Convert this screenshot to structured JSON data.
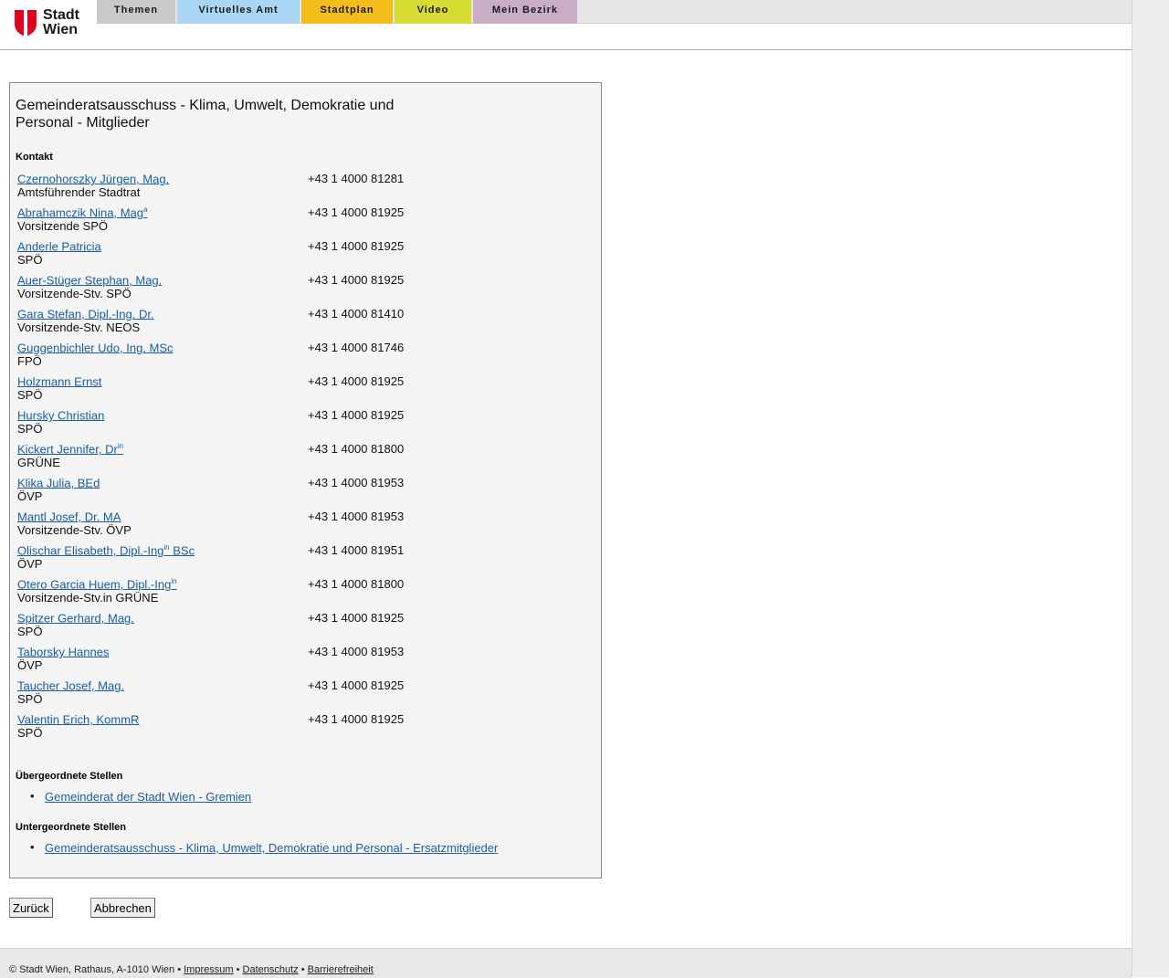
{
  "logo": {
    "line1": "Stadt",
    "line2": "Wien"
  },
  "nav": {
    "tabs": [
      {
        "label": "Themen",
        "color": "#c9c9c9"
      },
      {
        "label": "Virtuelles Amt",
        "color": "#a9d6f2"
      },
      {
        "label": "Stadtplan",
        "color": "#f3be19"
      },
      {
        "label": "Video",
        "color": "#d7dc32"
      },
      {
        "label": "Mein Bezirk",
        "color": "#c9adc6"
      }
    ]
  },
  "panel": {
    "title": "Gemeinderatsausschuss - Klima, Umwelt, Demokratie und Personal - Mitglieder",
    "contact_heading": "Kontakt",
    "members": [
      {
        "name": "Czernohorszky Jürgen, Mag.",
        "sup": "",
        "name_suffix": "",
        "role": "Amtsführender Stadtrat",
        "phone": "+43 1 4000 81281"
      },
      {
        "name": "Abrahamczik Nina, Mag",
        "sup": "a",
        "name_suffix": "",
        "role": "Vorsitzende SPÖ",
        "phone": "+43 1 4000 81925"
      },
      {
        "name": "Anderle Patricia",
        "sup": "",
        "name_suffix": "",
        "role": "SPÖ",
        "phone": "+43 1 4000 81925"
      },
      {
        "name": "Auer-Stüger Stephan, Mag.",
        "sup": "",
        "name_suffix": "",
        "role": "Vorsitzende-Stv. SPÖ",
        "phone": "+43 1 4000 81925"
      },
      {
        "name": "Gara Stefan, Dipl.-Ing. Dr.",
        "sup": "",
        "name_suffix": "",
        "role": "Vorsitzende-Stv. NEOS",
        "phone": "+43 1 4000 81410"
      },
      {
        "name": "Guggenbichler Udo, Ing. MSc",
        "sup": "",
        "name_suffix": "",
        "role": "FPÖ",
        "phone": "+43 1 4000 81746"
      },
      {
        "name": "Holzmann Ernst",
        "sup": "",
        "name_suffix": "",
        "role": "SPÖ",
        "phone": "+43 1 4000 81925"
      },
      {
        "name": "Hursky Christian",
        "sup": "",
        "name_suffix": "",
        "role": "SPÖ",
        "phone": "+43 1 4000 81925"
      },
      {
        "name": "Kickert Jennifer, Dr",
        "sup": "in",
        "name_suffix": "",
        "role": "GRÜNE",
        "phone": "+43 1 4000 81800"
      },
      {
        "name": "Klika Julia, BEd",
        "sup": "",
        "name_suffix": "",
        "role": "ÖVP",
        "phone": "+43 1 4000 81953"
      },
      {
        "name": "Mantl Josef, Dr. MA",
        "sup": "",
        "name_suffix": "",
        "role": "Vorsitzende-Stv. ÖVP",
        "phone": "+43 1 4000 81953"
      },
      {
        "name": "Olischar Elisabeth, Dipl.-Ing",
        "sup": "in",
        "name_suffix": " BSc",
        "role": "ÖVP",
        "phone": "+43 1 4000 81951"
      },
      {
        "name": "Otero Garcia Huem, Dipl.-Ing",
        "sup": "in",
        "name_suffix": "",
        "role": "Vorsitzende-Stv.in GRÜNE",
        "phone": "+43 1 4000 81800"
      },
      {
        "name": "Spitzer Gerhard, Mag.",
        "sup": "",
        "name_suffix": "",
        "role": "SPÖ",
        "phone": "+43 1 4000 81925"
      },
      {
        "name": "Taborsky Hannes",
        "sup": "",
        "name_suffix": "",
        "role": "ÖVP",
        "phone": "+43 1 4000 81953"
      },
      {
        "name": "Taucher Josef, Mag.",
        "sup": "",
        "name_suffix": "",
        "role": "SPÖ",
        "phone": "+43 1 4000 81925"
      },
      {
        "name": "Valentin Erich, KommR",
        "sup": "",
        "name_suffix": "",
        "role": "SPÖ",
        "phone": "+43 1 4000 81925"
      }
    ],
    "parent_heading": "Übergeordnete Stellen",
    "parent_links": [
      "Gemeinderat der Stadt Wien - Gremien"
    ],
    "child_heading": "Untergeordnete Stellen",
    "child_links": [
      "Gemeinderatsausschuss - Klima, Umwelt, Demokratie und Personal - Ersatzmitglieder"
    ]
  },
  "buttons": {
    "back": "Zurück",
    "cancel": "Abbrechen"
  },
  "footer": {
    "copyright": "© Stadt Wien, Rathaus, A-1010 Wien",
    "sep": "•",
    "links": [
      "Impressum",
      "Datenschutz",
      "Barrierefreiheit"
    ]
  },
  "colors": {
    "link": "#1a5fa0",
    "brand_red": "#e2001a"
  }
}
